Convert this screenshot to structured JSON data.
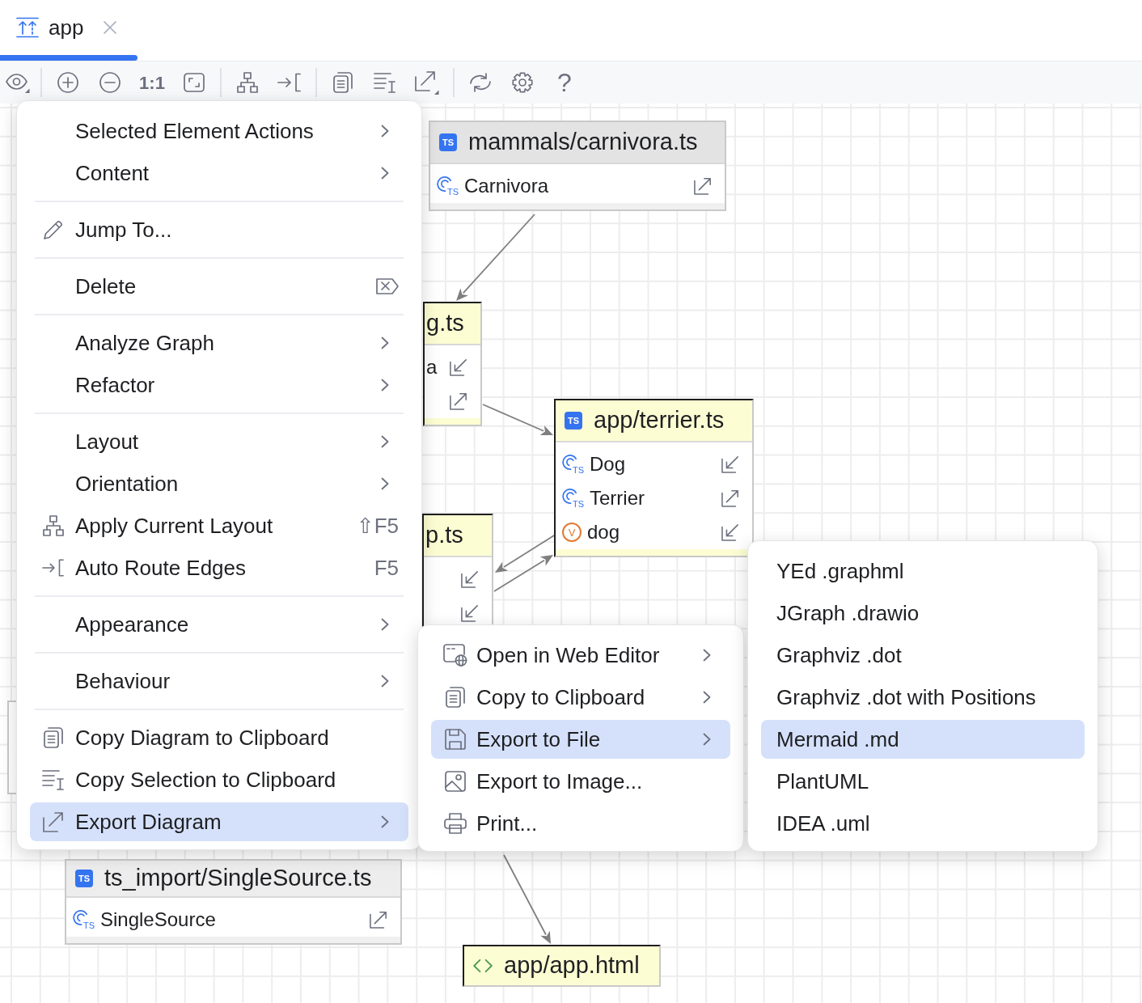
{
  "tab": {
    "label": "app",
    "selected": true
  },
  "toolbar": {
    "zoom_reset": "1:1",
    "help": "?"
  },
  "diagram": {
    "nodes": [
      {
        "title": "mammals/carnivora.ts",
        "kind": "ts",
        "badge": "TS",
        "highlighted": false,
        "members": [
          {
            "name": "Carnivora",
            "kind": "class",
            "badge": "TS",
            "outgoing": true
          }
        ]
      },
      {
        "title": "g.ts",
        "highlighted": true,
        "members": [
          {
            "name": "a",
            "outgoing": false
          },
          {
            "outgoing": true
          }
        ]
      },
      {
        "title": "app/terrier.ts",
        "kind": "ts",
        "badge": "TS",
        "highlighted": true,
        "members": [
          {
            "name": "Dog",
            "kind": "class",
            "badge": "TS",
            "outgoing": false
          },
          {
            "name": "Terrier",
            "kind": "class",
            "badge": "TS",
            "outgoing": true
          },
          {
            "name": "dog",
            "kind": "variable",
            "badge": "V",
            "outgoing": false
          }
        ]
      },
      {
        "title": "p.ts",
        "highlighted": true,
        "members": [
          {
            "outgoing": false
          },
          {
            "outgoing": false
          }
        ]
      },
      {
        "title": "ts_import/SingleSource.ts",
        "kind": "ts",
        "badge": "TS",
        "highlighted": false,
        "members": [
          {
            "name": "SingleSource",
            "kind": "class",
            "badge": "TS",
            "outgoing": true
          }
        ]
      },
      {
        "title": "app/app.html",
        "kind": "html",
        "highlighted": true
      },
      {
        "highlighted": false
      }
    ]
  },
  "context_menu": {
    "sections": [
      [
        {
          "label": "Selected Element Actions",
          "has_submenu": true,
          "selected": false
        },
        {
          "label": "Content",
          "has_submenu": true,
          "selected": false
        }
      ],
      [
        {
          "label": "Jump To...",
          "has_submenu": false,
          "selected": false
        }
      ],
      [
        {
          "label": "Delete",
          "has_submenu": false,
          "selected": false
        }
      ],
      [
        {
          "label": "Analyze Graph",
          "has_submenu": true,
          "selected": false
        },
        {
          "label": "Refactor",
          "has_submenu": true,
          "selected": false
        }
      ],
      [
        {
          "label": "Layout",
          "has_submenu": true,
          "selected": false
        },
        {
          "label": "Orientation",
          "has_submenu": true,
          "selected": false
        },
        {
          "label": "Apply Current Layout",
          "shortcut": "⇧F5",
          "has_submenu": false,
          "selected": false
        },
        {
          "label": "Auto Route Edges",
          "shortcut": "F5",
          "has_submenu": false,
          "selected": false
        }
      ],
      [
        {
          "label": "Appearance",
          "has_submenu": true,
          "selected": false
        }
      ],
      [
        {
          "label": "Behaviour",
          "has_submenu": true,
          "selected": false
        }
      ],
      [
        {
          "label": "Copy Diagram to Clipboard",
          "has_submenu": false,
          "selected": false
        },
        {
          "label": "Copy Selection to Clipboard",
          "has_submenu": false,
          "selected": false
        },
        {
          "label": "Export Diagram",
          "has_submenu": true,
          "selected": true
        }
      ]
    ]
  },
  "export_submenu": {
    "items": [
      {
        "label": "Open in Web Editor",
        "has_submenu": true,
        "selected": false
      },
      {
        "label": "Copy to Clipboard",
        "has_submenu": true,
        "selected": false
      },
      {
        "label": "Export to File",
        "has_submenu": true,
        "selected": true
      },
      {
        "label": "Export to Image...",
        "has_submenu": false,
        "selected": false
      },
      {
        "label": "Print...",
        "has_submenu": false,
        "selected": false
      }
    ]
  },
  "format_submenu": {
    "items": [
      {
        "label": "YEd .graphml",
        "selected": false
      },
      {
        "label": "JGraph .drawio",
        "selected": false
      },
      {
        "label": "Graphviz .dot",
        "selected": false
      },
      {
        "label": "Graphviz .dot with Positions",
        "selected": false
      },
      {
        "label": "Mermaid .md",
        "selected": true
      },
      {
        "label": "PlantUML",
        "selected": false
      },
      {
        "label": "IDEA .uml",
        "selected": false
      }
    ]
  }
}
